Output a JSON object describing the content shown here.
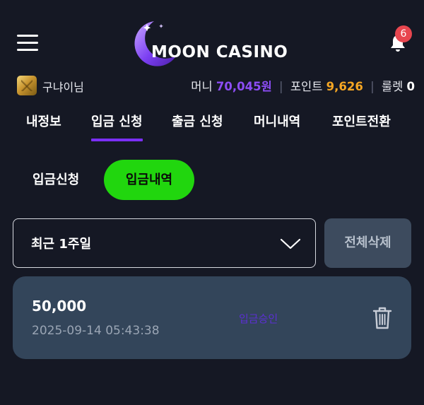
{
  "header": {
    "logo_text": "MOON CASINO",
    "notification_count": "6",
    "icons": {
      "menu": "hamburger-icon",
      "notifications": "bell-icon",
      "logo_mark": "crescent-moon-icon"
    }
  },
  "user": {
    "name": "구냐이님",
    "money_label": "머니",
    "money_value": "70,045원",
    "point_label": "포인트",
    "point_value": "9,626",
    "roulette_label": "룰렛",
    "roulette_value": "0"
  },
  "tabs": [
    {
      "label": "내정보",
      "active": false
    },
    {
      "label": "입금 신청",
      "active": true
    },
    {
      "label": "출금 신청",
      "active": false
    },
    {
      "label": "머니내역",
      "active": false
    },
    {
      "label": "포인트전환",
      "active": false
    }
  ],
  "subtabs": {
    "deposit_request": "입금신청",
    "deposit_history": "입금내역",
    "active": "deposit_history"
  },
  "filter": {
    "period_selected": "최근 1주일",
    "delete_all_label": "전체삭제"
  },
  "records": [
    {
      "amount": "50,000",
      "datetime": "2025-09-14 05:43:38",
      "status": "입금승인"
    }
  ],
  "colors": {
    "background": "#151824",
    "accent_purple": "#7b2ff7",
    "money_purple": "#8c4df5",
    "point_orange": "#f5a623",
    "active_green": "#21d60e",
    "card_bg": "#33455a",
    "button_bg": "#3d4b5e",
    "badge_red": "#e8464f"
  }
}
